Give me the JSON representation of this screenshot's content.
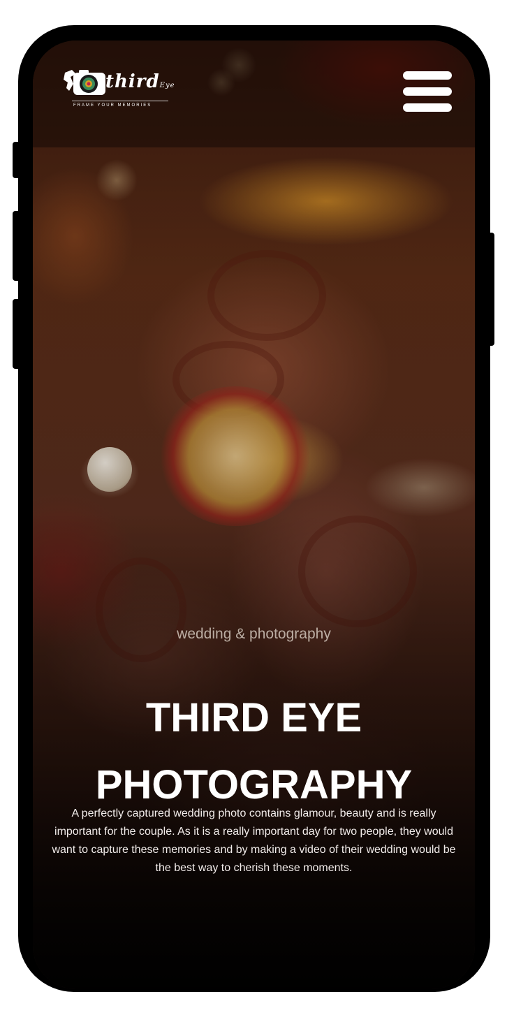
{
  "header": {
    "logo": {
      "name": "third",
      "name_suffix": "Eye",
      "tagline": "FRAME YOUR MEMORIES"
    },
    "menu_icon": "hamburger-menu-icon"
  },
  "hero": {
    "subtitle": "wedding & photography",
    "title_line1": "THIRD EYE",
    "title_line2": "PHOTOGRAPHY",
    "description": "A perfectly captured wedding photo contains glamour, beauty and is really important for the couple. As it is a really important day for two people, they would want to capture these memories and by making a video of their wedding would be the best way to cherish these moments."
  },
  "colors": {
    "phone_frame": "#000000",
    "text_primary": "#ffffff",
    "subtitle": "#e6dcd2"
  }
}
